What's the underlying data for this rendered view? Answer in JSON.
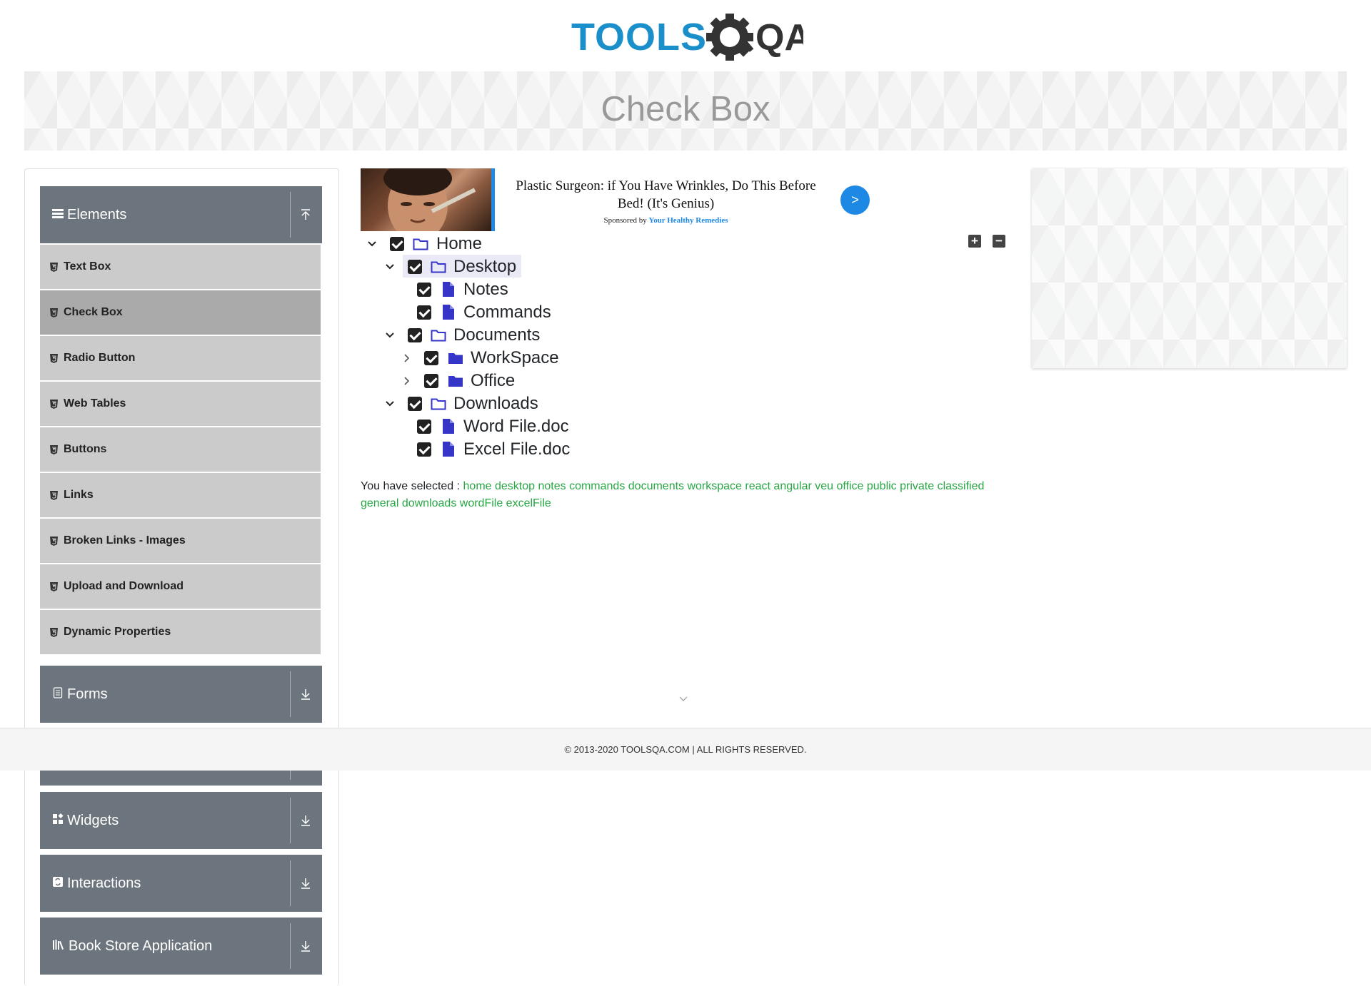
{
  "logo": {
    "text_left": "TOOLS",
    "text_right": "QA",
    "brand_color": "#1b8fc9",
    "dark_color": "#333"
  },
  "banner": {
    "title": "Check Box"
  },
  "sidebar": {
    "groups": [
      {
        "label": "Elements",
        "icon": "list-icon",
        "arrow": "collapse-up-icon"
      },
      {
        "label": "Forms",
        "icon": "document-icon",
        "arrow": "expand-down-icon"
      },
      {
        "label": "Widgets",
        "icon": "widgets-icon",
        "arrow": "expand-down-icon"
      },
      {
        "label": "Interactions",
        "icon": "interactions-icon",
        "arrow": "expand-down-icon"
      },
      {
        "label": "Book Store Application",
        "icon": "books-icon",
        "arrow": "expand-down-icon"
      }
    ],
    "items": [
      {
        "label": "Text Box"
      },
      {
        "label": "Check Box",
        "active": true
      },
      {
        "label": "Radio Button"
      },
      {
        "label": "Web Tables"
      },
      {
        "label": "Buttons"
      },
      {
        "label": "Links"
      },
      {
        "label": "Broken Links - Images"
      },
      {
        "label": "Upload and Download"
      },
      {
        "label": "Dynamic Properties"
      }
    ]
  },
  "ad": {
    "title": "Plastic Surgeon: if You Have Wrinkles, Do This Before Bed! (It's Genius)",
    "sponsor_prefix": "Sponsored by",
    "sponsor_name": "Your Healthy Remedies",
    "button": ">"
  },
  "tree": {
    "nodes": [
      {
        "label": "Home"
      },
      {
        "label": "Desktop"
      },
      {
        "label": "Notes"
      },
      {
        "label": "Commands"
      },
      {
        "label": "Documents"
      },
      {
        "label": "WorkSpace"
      },
      {
        "label": "Office"
      },
      {
        "label": "Downloads"
      },
      {
        "label": "Word File.doc"
      },
      {
        "label": "Excel File.doc"
      }
    ],
    "expand_all": "+",
    "collapse_all": "−"
  },
  "result": {
    "prefix": "You have selected :",
    "selected": "home desktop notes commands documents workspace react angular veu office public private classified general downloads wordFile excelFile"
  },
  "footer": {
    "text": "© 2013-2020 TOOLSQA.COM | ALL RIGHTS RESERVED."
  },
  "colors": {
    "sidebar_header": "#6c757d",
    "menu_item": "#cbcbcb",
    "menu_item_active": "#aaaaaa",
    "selected_text": "#28a745",
    "accent_blue": "#1e88e5",
    "tree_icon": "#3535c8"
  }
}
